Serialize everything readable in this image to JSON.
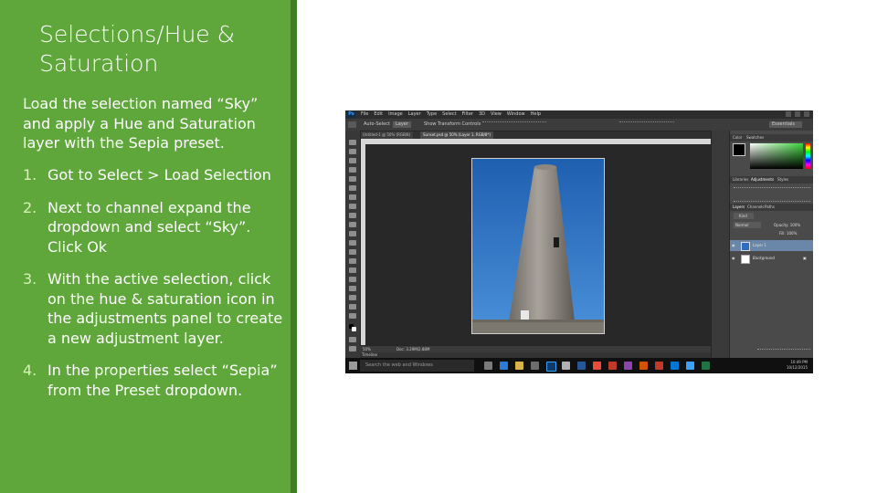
{
  "slide": {
    "title": "Selections/Hue & Saturation",
    "intro": "Load the selection named “Sky” and apply a Hue and Saturation layer with the Sepia preset.",
    "steps": [
      {
        "num": "1.",
        "text": "Got to Select > Load Selection"
      },
      {
        "num": "2.",
        "text": "Next to channel expand the dropdown and select “Sky”. Click Ok"
      },
      {
        "num": "3.",
        "text": "With the active selection, click on the hue & saturation icon in the adjustments panel to create a new adjustment layer."
      },
      {
        "num": "4.",
        "text": "In the properties select “Sepia” from the Preset dropdown."
      }
    ],
    "colors": {
      "panel": "#5fa63b",
      "panel_edge": "#3f7d25",
      "number": "#d8f2b9"
    }
  },
  "screenshot": {
    "logo": "Ps",
    "menus": [
      "File",
      "Edit",
      "Image",
      "Layer",
      "Type",
      "Select",
      "Filter",
      "3D",
      "View",
      "Window",
      "Help"
    ],
    "options": {
      "auto_select": "Auto-Select",
      "layer": "Layer",
      "show_transform": "Show Transform Controls",
      "workspace": "Essentials"
    },
    "tabs": [
      "Untitled-1 @ 50% (RGB/8)",
      "Sunset.psd @ 50% (Layer 1, RGB/8*)"
    ],
    "status": {
      "zoom": "50%",
      "doc": "Doc: 3.29M/2.88M"
    },
    "timeline": "Timeline",
    "panels": {
      "color_tabs": [
        "Color",
        "Swatches"
      ],
      "adjust_tabs": [
        "Libraries",
        "Adjustments",
        "Styles"
      ],
      "layers_tabs": [
        "Layers",
        "Channels",
        "Paths"
      ],
      "kind": "Kind",
      "blend": "Normal",
      "opacity": "Opacity: 100%",
      "fill": "Fill: 100%",
      "layers": [
        "Layer 1",
        "Background"
      ]
    },
    "taskbar": {
      "search": "Search the web and Windows",
      "time": "10:49 PM",
      "date": "10/12/2015"
    }
  }
}
